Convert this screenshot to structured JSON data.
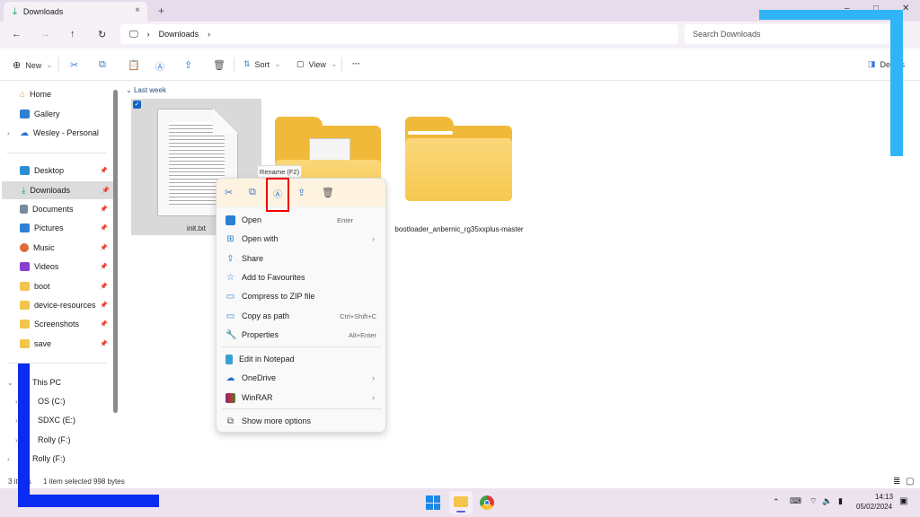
{
  "window": {
    "tab_title": "Downloads",
    "tab_icon": "download-icon",
    "new_tab_label": "+",
    "close_tab": "×",
    "controls": {
      "minimize": "–",
      "maximize": "□",
      "close": "✕"
    }
  },
  "nav": {
    "back": "←",
    "forward": "→",
    "up": "↑",
    "refresh": "↻",
    "breadcrumb": [
      "Downloads"
    ],
    "search_placeholder": "Search Downloads"
  },
  "toolbar": {
    "new_label": "New",
    "sort_label": "Sort",
    "view_label": "View",
    "more_label": "···",
    "details_label": "Details"
  },
  "sidebar": {
    "quick": [
      {
        "label": "Home",
        "icon": "home-icon",
        "color": "#e58f3b"
      },
      {
        "label": "Gallery",
        "icon": "gallery-icon",
        "color": "#2f7fd4"
      },
      {
        "label": "Wesley - Personal",
        "icon": "onedrive-icon",
        "color": "#1e73d6"
      }
    ],
    "pinned": [
      {
        "label": "Desktop",
        "icon": "desktop-icon",
        "color": "#2a8fd6"
      },
      {
        "label": "Downloads",
        "icon": "download-icon",
        "color": "#1a9e6e",
        "selected": true
      },
      {
        "label": "Documents",
        "icon": "documents-icon",
        "color": "#7a8aa0"
      },
      {
        "label": "Pictures",
        "icon": "pictures-icon",
        "color": "#2f7fd4"
      },
      {
        "label": "Music",
        "icon": "music-icon",
        "color": "#e06a3b"
      },
      {
        "label": "Videos",
        "icon": "videos-icon",
        "color": "#8b3fd0"
      },
      {
        "label": "boot",
        "icon": "folder-icon",
        "color": "#f3c54c"
      },
      {
        "label": "device-resources",
        "icon": "folder-icon",
        "color": "#f3c54c"
      },
      {
        "label": "Screenshots",
        "icon": "folder-icon",
        "color": "#f3c54c"
      },
      {
        "label": "save",
        "icon": "folder-icon",
        "color": "#f3c54c"
      }
    ],
    "this_pc": {
      "label": "This PC",
      "drives": [
        "OS (C:)",
        "SDXC (E:)",
        "Rolly (F:)",
        "Rolly (F:)"
      ]
    }
  },
  "content": {
    "group_label": "Last week",
    "files": [
      {
        "name": "init.txt",
        "type": "text",
        "selected": true
      },
      {
        "name": "",
        "type": "folder-with-doc"
      },
      {
        "name": "bootloader_anbernic_rg35xxplus-master",
        "type": "folder"
      }
    ]
  },
  "context_menu": {
    "tooltip": "Rename (F2)",
    "quick_actions": [
      "cut",
      "copy",
      "rename",
      "share",
      "delete"
    ],
    "items": [
      {
        "label": "Open",
        "shortcut": "Enter",
        "icon": "notepad-icon"
      },
      {
        "label": "Open with",
        "submenu": true,
        "icon": "open-with-icon"
      },
      {
        "label": "Share",
        "icon": "share-icon"
      },
      {
        "label": "Add to Favourites",
        "icon": "star-icon"
      },
      {
        "label": "Compress to ZIP file",
        "icon": "zip-icon"
      },
      {
        "label": "Copy as path",
        "shortcut": "Ctrl+Shift+C",
        "icon": "path-icon"
      },
      {
        "label": "Properties",
        "shortcut": "Alt+Enter",
        "icon": "wrench-icon"
      },
      {
        "label": "Edit in Notepad",
        "icon": "notepad-icon"
      },
      {
        "label": "OneDrive",
        "submenu": true,
        "icon": "onedrive-icon"
      },
      {
        "label": "WinRAR",
        "submenu": true,
        "icon": "winrar-icon"
      },
      {
        "label": "Show more options",
        "icon": "more-options-icon"
      }
    ]
  },
  "status": {
    "items": "3 items",
    "selection": "1 item selected  998 bytes"
  },
  "taskbar": {
    "time": "14:13",
    "date": "05/02/2024"
  }
}
